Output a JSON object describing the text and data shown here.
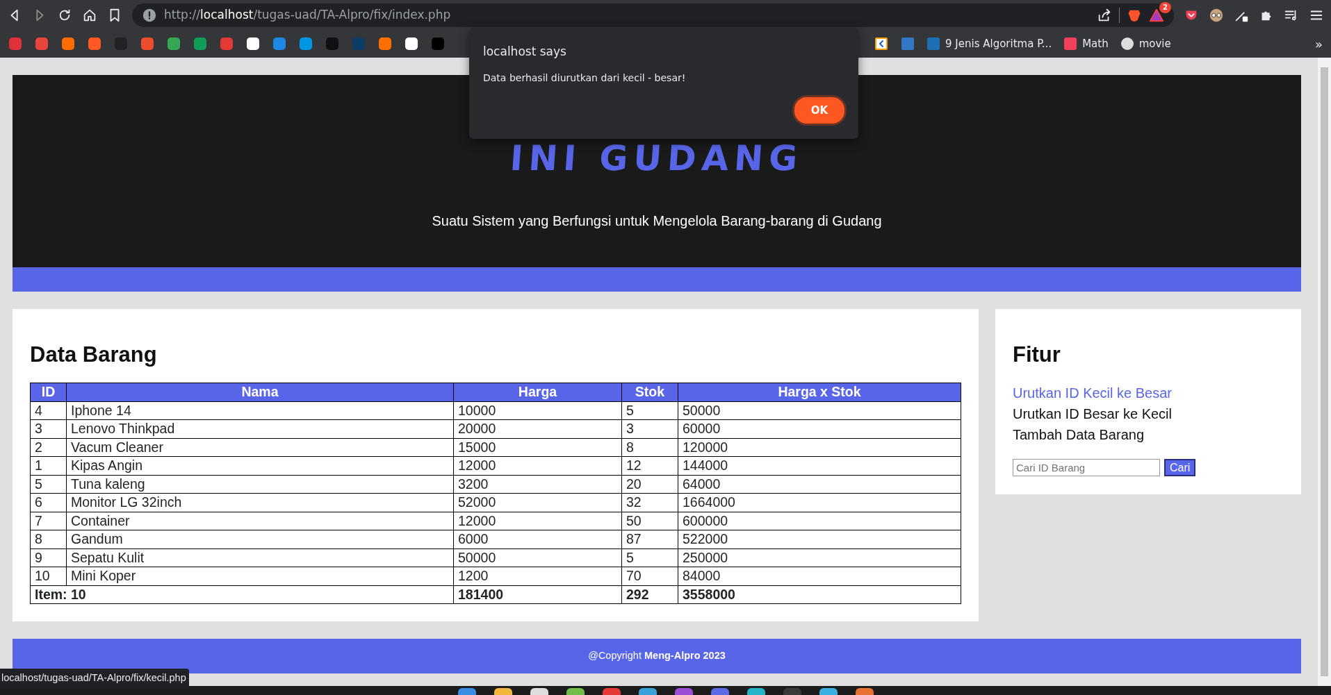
{
  "browser": {
    "url_scheme": "http://",
    "url_host": "localhost",
    "url_path": "/tugas-uad/TA-Alpro/fix/index.php",
    "notification_count": "2",
    "bookmarks": [
      {
        "label": "9 Jenis Algoritma P...",
        "color": "#1f6fb5"
      },
      {
        "label": "Math",
        "color": "#f0405a"
      },
      {
        "label": "movie",
        "color": "#dddddd"
      }
    ],
    "overflow": "»"
  },
  "header": {
    "title": "INI GUDANG",
    "subtitle": "Suatu Sistem yang Berfungsi untuk Mengelola Barang-barang di Gudang"
  },
  "data_section": {
    "heading": "Data Barang",
    "columns": [
      "ID",
      "Nama",
      "Harga",
      "Stok",
      "Harga x Stok"
    ],
    "rows": [
      [
        "4",
        "Iphone 14",
        "10000",
        "5",
        "50000"
      ],
      [
        "3",
        "Lenovo Thinkpad",
        "20000",
        "3",
        "60000"
      ],
      [
        "2",
        "Vacum Cleaner",
        "15000",
        "8",
        "120000"
      ],
      [
        "1",
        "Kipas Angin",
        "12000",
        "12",
        "144000"
      ],
      [
        "5",
        "Tuna kaleng",
        "3200",
        "20",
        "64000"
      ],
      [
        "6",
        "Monitor LG 32inch",
        "52000",
        "32",
        "1664000"
      ],
      [
        "7",
        "Container",
        "12000",
        "50",
        "600000"
      ],
      [
        "8",
        "Gandum",
        "6000",
        "87",
        "522000"
      ],
      [
        "9",
        "Sepatu Kulit",
        "50000",
        "5",
        "250000"
      ],
      [
        "10",
        "Mini Koper",
        "1200",
        "70",
        "84000"
      ]
    ],
    "totals": [
      "Item: 10",
      "181400",
      "292",
      "3558000"
    ]
  },
  "sidebar": {
    "heading": "Fitur",
    "links": [
      {
        "label": "Urutkan ID Kecil ke Besar",
        "hovered": true
      },
      {
        "label": "Urutkan ID Besar ke Kecil",
        "hovered": false
      },
      {
        "label": "Tambah Data Barang",
        "hovered": false
      }
    ],
    "search": {
      "placeholder": "Cari ID Barang"
    },
    "search_button": "Cari"
  },
  "footer": {
    "text": "@Copyright **Meng-Alpro 2023**"
  },
  "status_url": "localhost/tugas-uad/TA-Alpro/fix/kecil.php",
  "dialog": {
    "title": "localhost says",
    "message": "Data berhasil diurutkan dari kecil - besar!",
    "button": "OK"
  }
}
